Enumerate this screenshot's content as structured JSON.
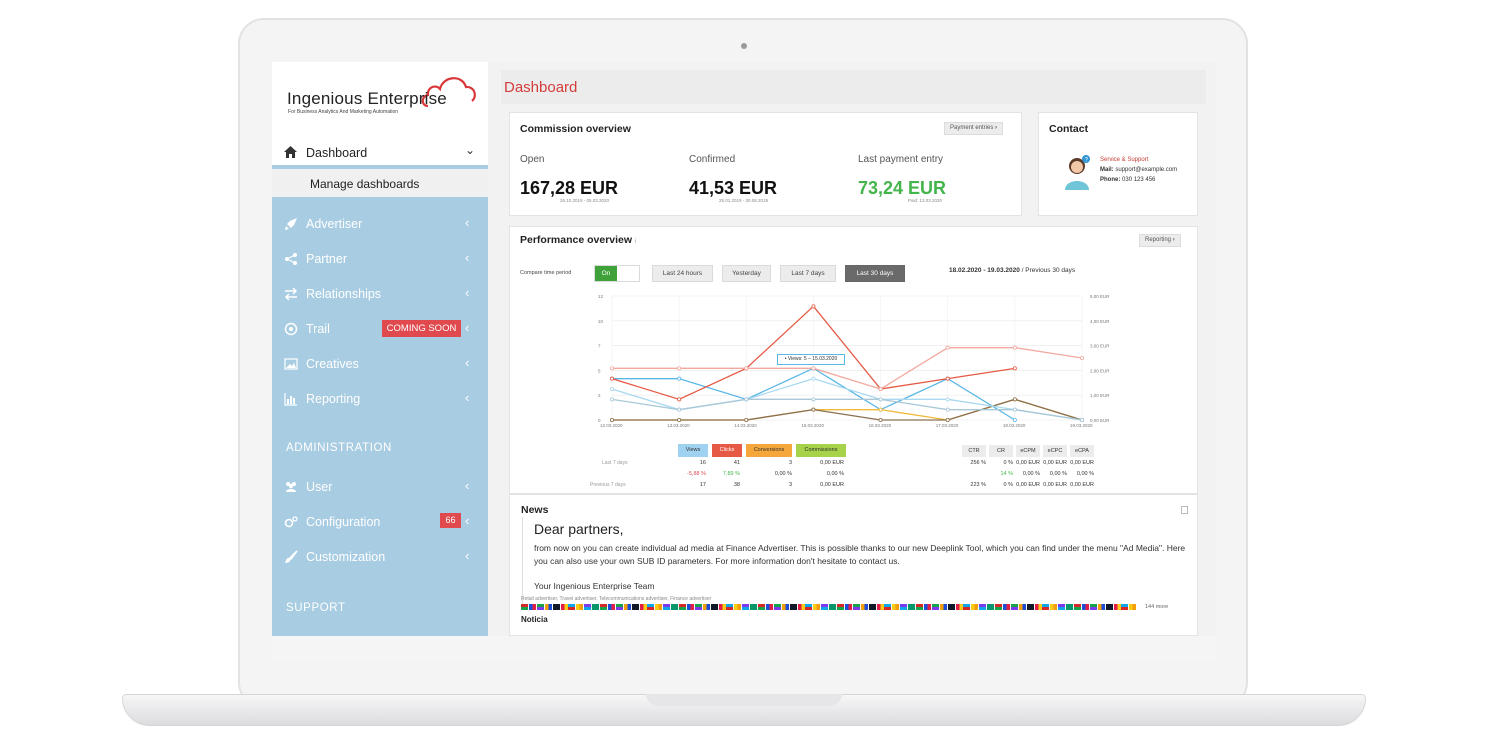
{
  "sidebar": {
    "logo_title": "Ingenious Enterprise",
    "logo_subtitle": "For Business Analytics And Marketing Automation",
    "dashboard_label": "Dashboard",
    "manage_label": "Manage dashboards",
    "items": [
      {
        "label": "Advertiser",
        "icon": "rocket-icon"
      },
      {
        "label": "Partner",
        "icon": "share-icon"
      },
      {
        "label": "Relationships",
        "icon": "arrows-icon"
      },
      {
        "label": "Trail",
        "icon": "target-icon"
      },
      {
        "label": "Creatives",
        "icon": "image-icon"
      },
      {
        "label": "Reporting",
        "icon": "bar-chart-icon"
      }
    ],
    "coming_soon": "COMING SOON",
    "administration": "ADMINISTRATION",
    "admin_items": [
      {
        "label": "User",
        "icon": "users-icon"
      },
      {
        "label": "Configuration",
        "icon": "gears-icon"
      },
      {
        "label": "Customization",
        "icon": "brush-icon"
      }
    ],
    "config_badge": "66",
    "support": "SUPPORT"
  },
  "header": {
    "title": "Dashboard"
  },
  "commission": {
    "title": "Commission overview",
    "button": "Payment entries",
    "open_label": "Open",
    "open_value": "167,28 EUR",
    "open_dates": "26.10.2019 - 05.03.2020",
    "confirmed_label": "Confirmed",
    "confirmed_value": "41,53 EUR",
    "confirmed_dates": "25.01.2019 - 30.08.2019",
    "last_label": "Last payment entry",
    "last_value": "73,24 EUR",
    "last_dates": "Paid: 13.03.2020"
  },
  "contact": {
    "title": "Contact",
    "service": "Service & Support",
    "mail_label": "Mail:",
    "mail": "support@example.com",
    "phone_label": "Phone:",
    "phone": "030 123 456"
  },
  "performance": {
    "title": "Performance overview",
    "info": "i",
    "button": "Reporting",
    "compare_label": "Compare time period",
    "toggle_on": "On",
    "periods": [
      "Last 24 hours",
      "Yesterday",
      "Last 7 days",
      "Last 30 days"
    ],
    "range_bold": "18.02.2020 - 19.03.2020",
    "range_rest": "/ Previous 30 days",
    "tooltip": "• Views: 5 – 15.03.2020"
  },
  "chart_data": {
    "type": "line",
    "x": [
      "12.03.2020",
      "13.03.2020",
      "14.03.2020",
      "15.03.2020",
      "16.03.2020",
      "17.03.2020",
      "18.03.2020",
      "19.03.2020"
    ],
    "y_left_ticks": [
      "12",
      "10",
      "7",
      "5",
      "2",
      "0"
    ],
    "y_right_ticks": [
      "5,00 EUR",
      "4,00 EUR",
      "3,00 EUR",
      "2,00 EUR",
      "1,00 EUR",
      "0,00 EUR"
    ],
    "ylim": [
      0,
      12
    ],
    "series": [
      {
        "name": "Views",
        "color": "#5bb7e6",
        "values": [
          4,
          4,
          2,
          5,
          1,
          4,
          0,
          null
        ]
      },
      {
        "name": "Clicks",
        "color": "#e65a45",
        "values": [
          4,
          2,
          5,
          11,
          3,
          4,
          5,
          null
        ]
      },
      {
        "name": "Conversions",
        "color": "#f0b93b",
        "values": [
          0,
          0,
          0,
          1,
          1,
          0,
          2,
          0
        ]
      },
      {
        "name": "Commissions",
        "color": "#8a7050",
        "values": [
          0,
          0,
          0,
          1,
          0,
          0,
          2,
          0
        ]
      },
      {
        "name": "",
        "color": "#f2a9a0",
        "values": [
          5,
          5,
          5,
          5,
          3,
          7,
          7,
          6
        ]
      },
      {
        "name": "",
        "color": "#a9d8f0",
        "values": [
          3,
          1,
          2,
          4,
          2,
          2,
          1,
          0
        ]
      },
      {
        "name": "",
        "color": "#a8c8d8",
        "values": [
          2,
          1,
          2,
          2,
          2,
          1,
          1,
          0
        ]
      }
    ],
    "grid": true
  },
  "legend": [
    "Views",
    "Clicks",
    "Conversions",
    "Commissions"
  ],
  "legend_colors": [
    "#9fd2f0",
    "#e65a45",
    "#f5a73b",
    "#a6d34a"
  ],
  "stats": {
    "row_labels": [
      "Last 7 days",
      "",
      "Previous 7 days"
    ],
    "rows": [
      [
        "16",
        "41",
        "3",
        "0,00 EUR"
      ],
      [
        "-5,88 %",
        "7,89 %",
        "0,00 %",
        "0,00 %"
      ],
      [
        "17",
        "38",
        "3",
        "0,00 EUR"
      ]
    ],
    "kpi_heads": [
      "CTR",
      "CR",
      "eCPM",
      "eCPC",
      "eCPA"
    ],
    "kpi_rows": [
      [
        "256 %",
        "0 %",
        "0,00 EUR",
        "0,00 EUR",
        "0,00 EUR"
      ],
      [
        "",
        "14 %",
        "0,00 %",
        "0,00 %",
        "0,00 %"
      ],
      [
        "223 %",
        "0 %",
        "0,00 EUR",
        "0,00 EUR",
        "0,00 EUR"
      ]
    ]
  },
  "news": {
    "title": "News",
    "heading": "Dear partners,",
    "body": "from now on you can create individual ad media at Finance Advertiser. This is possible thanks to our new Deeplink Tool, which you can find under the menu \"Ad Media\". Here you can also use your own SUB ID parameters. For more information don't hesitate to contact us.",
    "signature": "Your Ingenious Enterprise Team",
    "tags": "Retail advertiser, Travel advertiser, Telecommunications advertiser, Finance advertiser",
    "more": "144 more",
    "next_title": "Noticia"
  }
}
